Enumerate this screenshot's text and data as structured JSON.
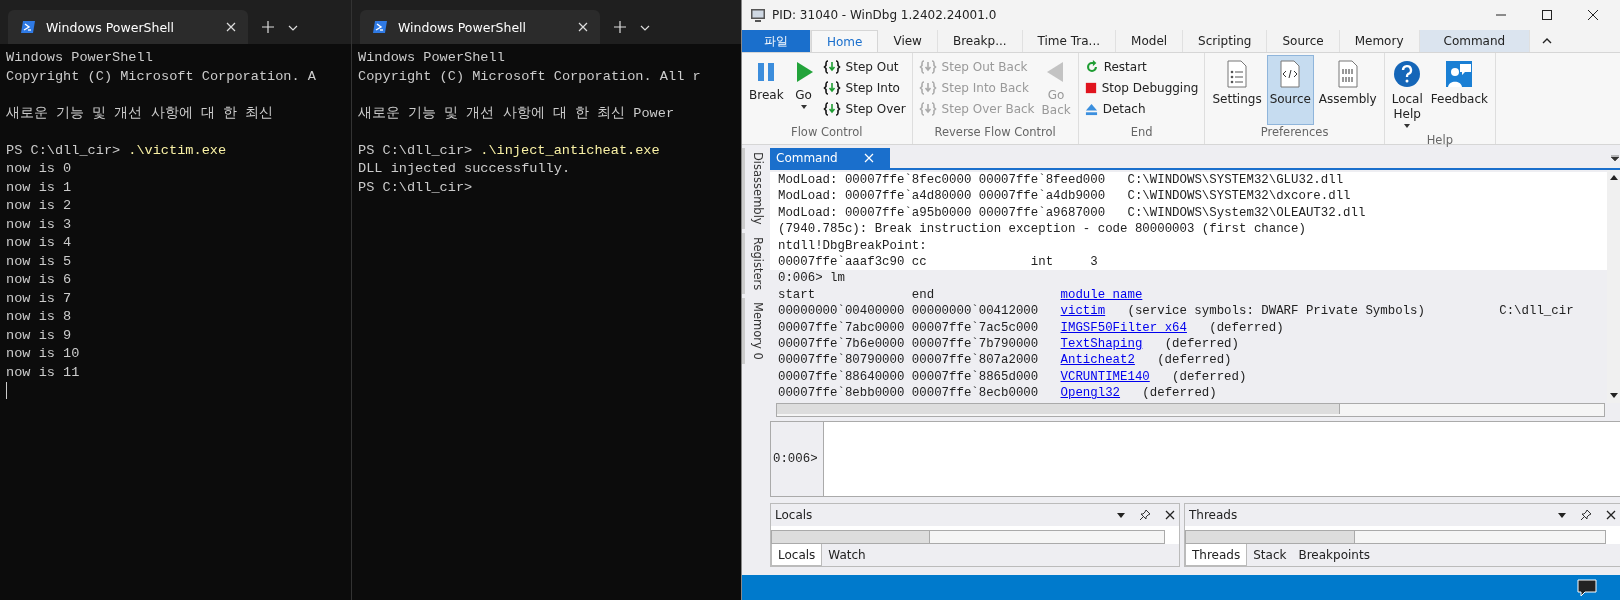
{
  "terminals": [
    {
      "tab_title": "Windows PowerShell",
      "lines": [
        {
          "kind": "text",
          "text": "Windows PowerShell"
        },
        {
          "kind": "text",
          "text": "Copyright (C) Microsoft Corporation. A"
        },
        {
          "kind": "blank"
        },
        {
          "kind": "text",
          "text": "새로운 기능 및 개선 사항에 대 한 최신"
        },
        {
          "kind": "blank"
        },
        {
          "kind": "prompt",
          "text": "PS C:\\dll_cir>",
          "command": ".\\victim.exe"
        },
        {
          "kind": "text",
          "text": "now is 0"
        },
        {
          "kind": "text",
          "text": "now is 1"
        },
        {
          "kind": "text",
          "text": "now is 2"
        },
        {
          "kind": "text",
          "text": "now is 3"
        },
        {
          "kind": "text",
          "text": "now is 4"
        },
        {
          "kind": "text",
          "text": "now is 5"
        },
        {
          "kind": "text",
          "text": "now is 6"
        },
        {
          "kind": "text",
          "text": "now is 7"
        },
        {
          "kind": "text",
          "text": "now is 8"
        },
        {
          "kind": "text",
          "text": "now is 9"
        },
        {
          "kind": "text",
          "text": "now is 10"
        },
        {
          "kind": "text",
          "text": "now is 11"
        }
      ],
      "cursor": true
    },
    {
      "tab_title": "Windows PowerShell",
      "lines": [
        {
          "kind": "text",
          "text": "Windows PowerShell"
        },
        {
          "kind": "text",
          "text": "Copyright (C) Microsoft Corporation. All r"
        },
        {
          "kind": "blank"
        },
        {
          "kind": "text",
          "text": "새로운 기능 및 개선 사항에 대 한 최신 Power"
        },
        {
          "kind": "blank"
        },
        {
          "kind": "prompt",
          "text": "PS C:\\dll_cir>",
          "command": ".\\inject_anticheat.exe"
        },
        {
          "kind": "text",
          "text": "DLL injected successfully."
        },
        {
          "kind": "prompt",
          "text": "PS C:\\dll_cir>"
        }
      ],
      "cursor": false
    }
  ],
  "windbg": {
    "title": "PID: 31040 - WinDbg 1.2402.24001.0",
    "ribbon_tabs": [
      {
        "label": "파일",
        "kind": "file",
        "selected": false
      },
      {
        "label": "Home",
        "kind": "normal",
        "selected": true
      },
      {
        "label": "View",
        "kind": "normal",
        "selected": false
      },
      {
        "label": "Breakp...",
        "kind": "normal",
        "selected": false
      },
      {
        "label": "Time Tra...",
        "kind": "normal",
        "selected": false
      },
      {
        "label": "Model",
        "kind": "normal",
        "selected": false
      },
      {
        "label": "Scripting",
        "kind": "normal",
        "selected": false
      },
      {
        "label": "Source",
        "kind": "normal",
        "selected": false
      },
      {
        "label": "Memory",
        "kind": "normal",
        "selected": false
      },
      {
        "label": "Command",
        "kind": "context",
        "selected": false
      }
    ],
    "groups": [
      {
        "label": "Flow Control",
        "columns": [
          {
            "kind": "large",
            "label": "Break",
            "disabled": false,
            "selected": false,
            "dropdown": false
          },
          {
            "kind": "large",
            "label": "Go",
            "disabled": false,
            "selected": false,
            "dropdown": true
          },
          {
            "kind": "stack",
            "items": [
              {
                "label": "Step Out",
                "disabled": false
              },
              {
                "label": "Step Into",
                "disabled": false
              },
              {
                "label": "Step Over",
                "disabled": false
              }
            ]
          }
        ]
      },
      {
        "label": "Reverse Flow Control",
        "columns": [
          {
            "kind": "stack",
            "items": [
              {
                "label": "Step Out Back",
                "disabled": true
              },
              {
                "label": "Step Into Back",
                "disabled": true
              },
              {
                "label": "Step Over Back",
                "disabled": true
              }
            ]
          },
          {
            "kind": "large",
            "label": "Go\nBack",
            "disabled": true,
            "selected": false,
            "dropdown": false
          }
        ]
      },
      {
        "label": "End",
        "columns": [
          {
            "kind": "stack",
            "items": [
              {
                "label": "Restart",
                "disabled": false
              },
              {
                "label": "Stop Debugging",
                "disabled": false
              },
              {
                "label": "Detach",
                "disabled": false
              }
            ]
          }
        ]
      },
      {
        "label": "Preferences",
        "columns": [
          {
            "kind": "large",
            "label": "Settings",
            "disabled": false,
            "selected": false,
            "dropdown": false
          },
          {
            "kind": "large",
            "label": "Source",
            "disabled": false,
            "selected": true,
            "dropdown": false
          },
          {
            "kind": "large",
            "label": "Assembly",
            "disabled": false,
            "selected": false,
            "dropdown": false
          }
        ]
      },
      {
        "label": "Help",
        "columns": [
          {
            "kind": "large",
            "label": "Local\nHelp",
            "disabled": false,
            "selected": false,
            "dropdown": true
          },
          {
            "kind": "large",
            "label": "Feedback",
            "disabled": false,
            "selected": false,
            "dropdown": false
          }
        ]
      }
    ],
    "side_tabs": [
      "Disassembly",
      "Registers",
      "Memory 0"
    ],
    "command_tab": "Command",
    "output": [
      {
        "kind": "plain",
        "text": "ModLoad: 00007ffe`8fec0000 00007ffe`8feed000   C:\\WINDOWS\\SYSTEM32\\GLU32.dll"
      },
      {
        "kind": "plain",
        "text": "ModLoad: 00007ffe`a4d80000 00007ffe`a4db9000   C:\\WINDOWS\\SYSTEM32\\dxcore.dll"
      },
      {
        "kind": "plain",
        "text": "ModLoad: 00007ffe`a95b0000 00007ffe`a9687000   C:\\WINDOWS\\System32\\OLEAUT32.dll"
      },
      {
        "kind": "plain",
        "text": "(7940.785c): Break instruction exception - code 80000003 (first chance)"
      },
      {
        "kind": "plain",
        "text": "ntdll!DbgBreakPoint:"
      },
      {
        "kind": "plain",
        "text": "00007ffe`aaaf3c90 cc              int     3"
      },
      {
        "kind": "input",
        "text": "0:006> lm"
      },
      {
        "kind": "module",
        "start": "start",
        "end": "end",
        "name": "module name"
      },
      {
        "kind": "module",
        "start": "00000000`00400000",
        "end": "00000000`00412000",
        "name": "victim",
        "info": "(service symbols: DWARF Private Symbols)",
        "path": "C:\\dll_cir"
      },
      {
        "kind": "module",
        "start": "00007ffe`7abc0000",
        "end": "00007ffe`7ac5c000",
        "name": "IMGSF50Filter_x64",
        "info": "(deferred)"
      },
      {
        "kind": "module",
        "start": "00007ffe`7b6e0000",
        "end": "00007ffe`7b790000",
        "name": "TextShaping",
        "info": "(deferred)"
      },
      {
        "kind": "module",
        "start": "00007ffe`80790000",
        "end": "00007ffe`807a2000",
        "name": "Anticheat2",
        "info": "(deferred)"
      },
      {
        "kind": "module",
        "start": "00007ffe`88640000",
        "end": "00007ffe`8865d000",
        "name": "VCRUNTIME140",
        "info": "(deferred)"
      },
      {
        "kind": "module",
        "start": "00007ffe`8ebb0000",
        "end": "00007ffe`8ecb0000",
        "name": "Opengl32",
        "info": "(deferred)"
      }
    ],
    "prompt": "0:006>",
    "panels": [
      {
        "title": "Locals",
        "tabs": [
          {
            "label": "Locals",
            "selected": true
          },
          {
            "label": "Watch",
            "selected": false
          }
        ]
      },
      {
        "title": "Threads",
        "tabs": [
          {
            "label": "Threads",
            "selected": true
          },
          {
            "label": "Stack",
            "selected": false
          },
          {
            "label": "Breakpoints",
            "selected": false
          }
        ]
      }
    ]
  }
}
